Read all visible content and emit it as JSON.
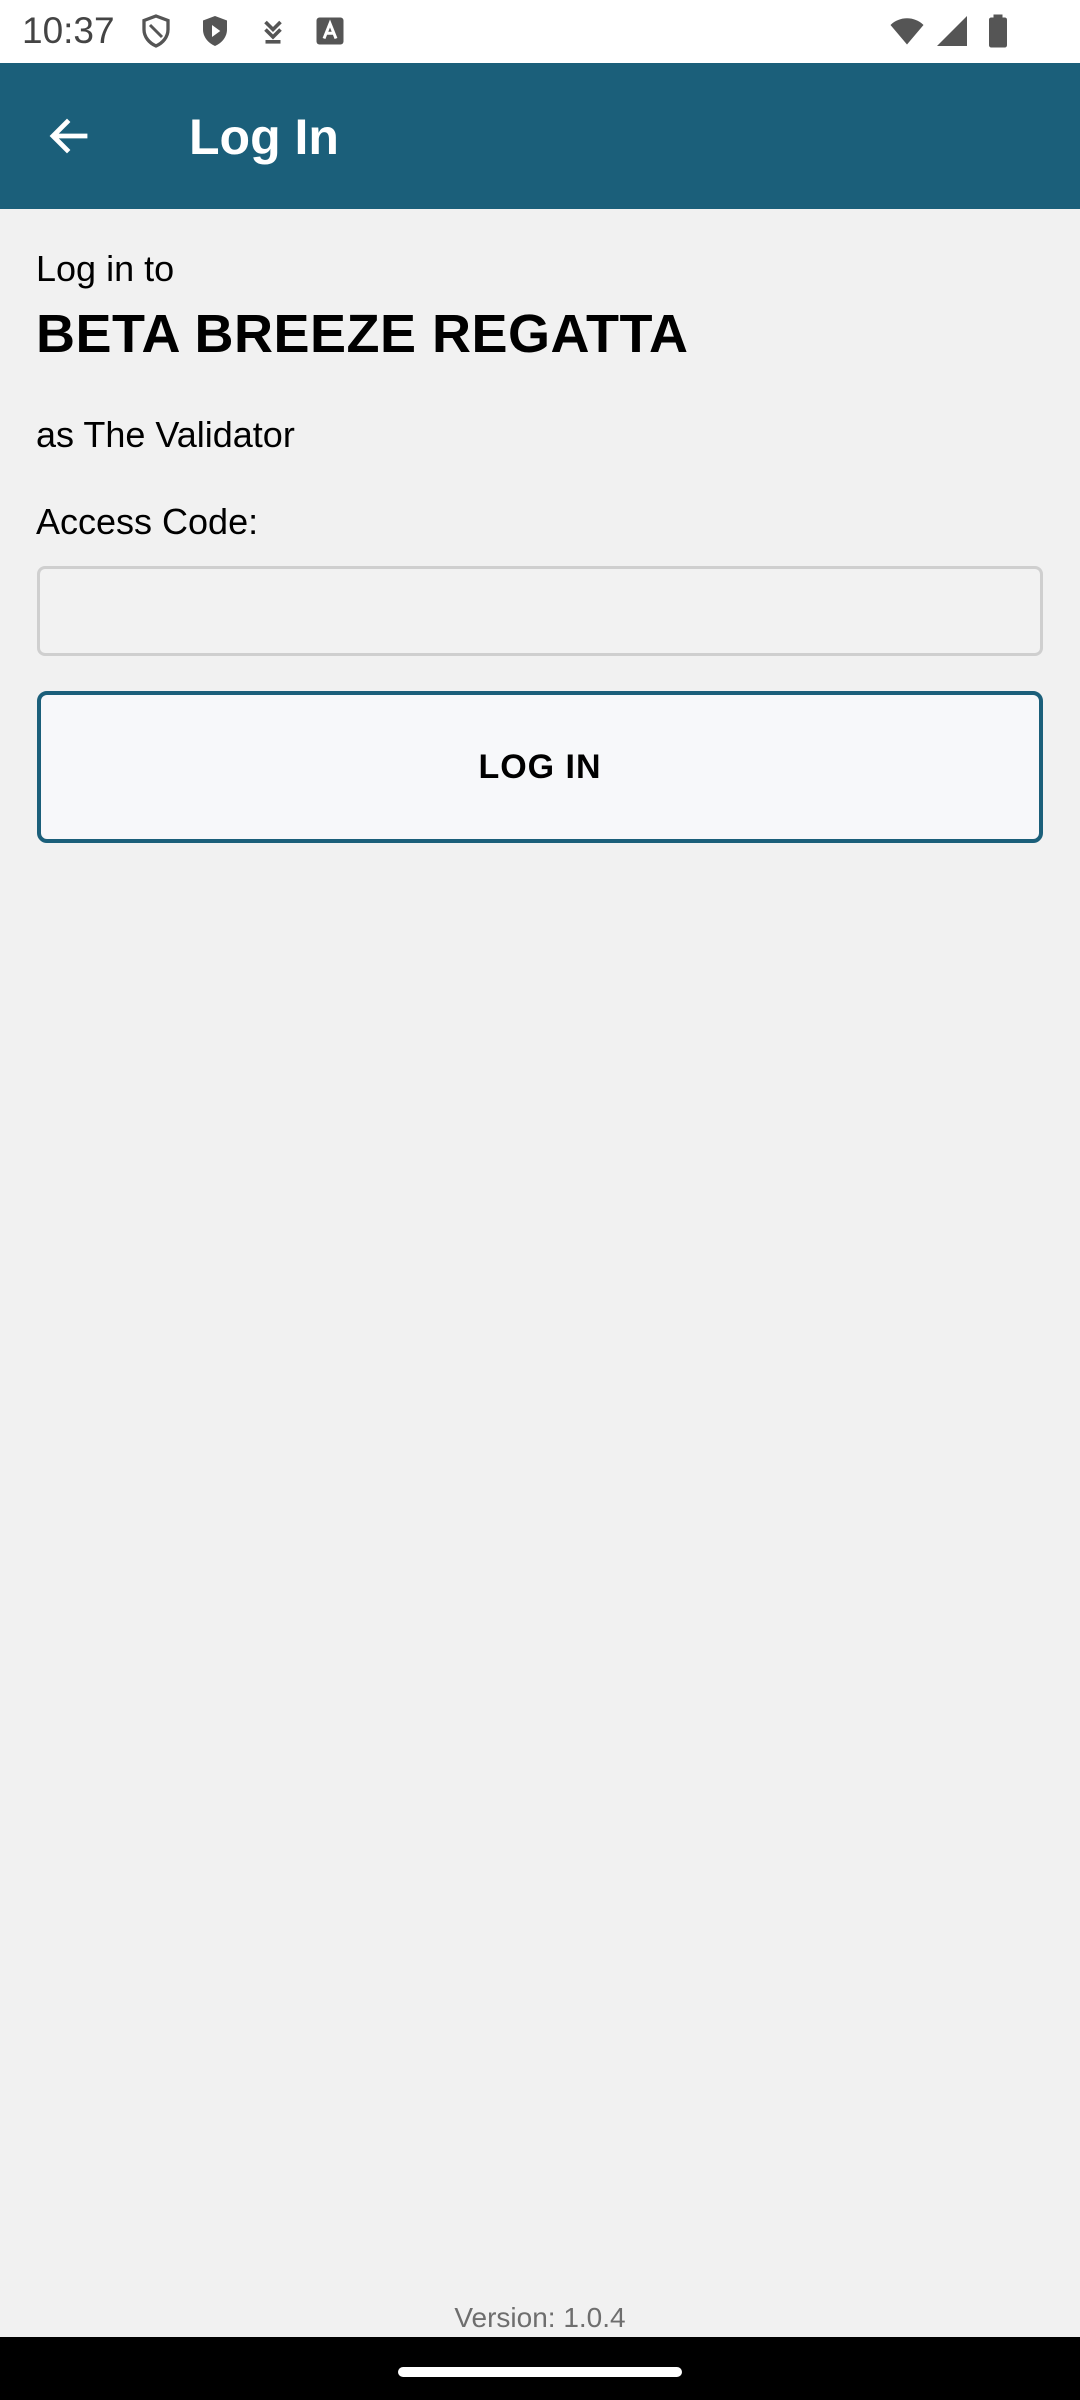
{
  "status_bar": {
    "time": "10:37",
    "icons_left": [
      "shield-outline-icon",
      "shield-play-icon",
      "download-icon",
      "font-a-icon"
    ],
    "icons_right": [
      "wifi-icon",
      "cellular-signal-icon",
      "battery-icon"
    ]
  },
  "app_bar": {
    "back_icon": "arrow-left-icon",
    "title": "Log In",
    "color": "#1b5f7a"
  },
  "content": {
    "intro": "Log in to",
    "event_name": "BETA BREEZE REGATTA",
    "as_user": "as The Validator",
    "access_label": "Access Code:",
    "access_value": "",
    "login_label": "LOG IN"
  },
  "footer": {
    "version": "Version: 1.0.4"
  }
}
